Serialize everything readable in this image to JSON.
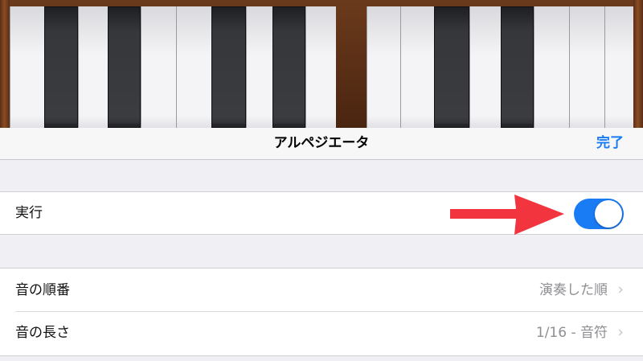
{
  "navbar": {
    "title": "アルペジエータ",
    "done_label": "完了"
  },
  "settings": {
    "run": {
      "label": "実行",
      "enabled": true
    },
    "note_order": {
      "label": "音の順番",
      "value": "演奏した順"
    },
    "note_length": {
      "label": "音の長さ",
      "value": "1/16 - 音符"
    }
  },
  "colors": {
    "accent": "#1a7cf5",
    "annotation_arrow": "#f2343f",
    "background": "#efeff4"
  },
  "icons": {
    "chevron": "chevron-right-icon",
    "arrow": "red-arrow-icon"
  }
}
